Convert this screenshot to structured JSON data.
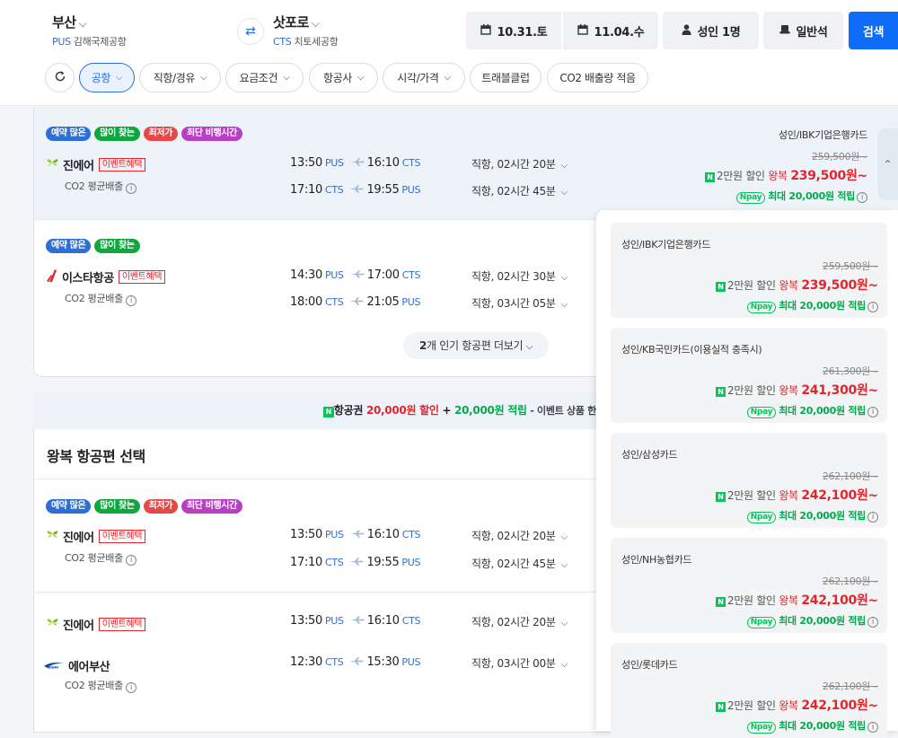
{
  "header": {
    "origin": {
      "city": "부산",
      "code": "PUS",
      "airport": "김해국제공항"
    },
    "destination": {
      "city": "삿포로",
      "code": "CTS",
      "airport": "치토세공항"
    },
    "swap_icon": "⇄",
    "depart_date": "10.31.토",
    "return_date": "11.04.수",
    "passengers": "성인 1명",
    "seat_class": "일반석",
    "search_label": "검색"
  },
  "filters": [
    "공항",
    "직항/경유",
    "요금조건",
    "항공사",
    "시각/가격",
    "트래블클럽",
    "CO2 배출량 적음"
  ],
  "badge_colors": {
    "예약 많은": "#2c6fd6",
    "많이 찾는": "#10a83e",
    "최저가": "#e54848",
    "최단 비행시간": "#b83fc4"
  },
  "labels": {
    "event": "이벤트혜택",
    "co2": "CO2 평균배출",
    "info": "i"
  },
  "results": [
    {
      "badges": [
        "예약 많은",
        "많이 찾는",
        "최저가",
        "최단 비행시간"
      ],
      "airline": "진에어",
      "event": true,
      "co2": true,
      "legs": [
        {
          "dep": "13:50",
          "dep_code": "PUS",
          "arr": "16:10",
          "arr_code": "CTS",
          "duration": "직항, 02시간 20분"
        },
        {
          "dep": "17:10",
          "dep_code": "CTS",
          "arr": "19:55",
          "arr_code": "PUS",
          "duration": "직항, 02시간 45분"
        }
      ],
      "price": {
        "card": "성인/IBK기업은행카드",
        "original": "259,500원~",
        "discount": "2만원 할인",
        "rt": "왕복",
        "price": "239,500원~",
        "point": "최대 20,000원 적립"
      }
    },
    {
      "badges": [
        "예약 많은",
        "많이 찾는"
      ],
      "airline": "이스타항공",
      "event": true,
      "co2": true,
      "legs": [
        {
          "dep": "14:30",
          "dep_code": "PUS",
          "arr": "17:00",
          "arr_code": "CTS",
          "duration": "직항, 02시간 30분"
        },
        {
          "dep": "18:00",
          "dep_code": "CTS",
          "arr": "21:05",
          "arr_code": "PUS",
          "duration": "직항, 03시간 05분"
        }
      ]
    }
  ],
  "more_button": {
    "count": "2",
    "text": "개 인기 항공편 더보기"
  },
  "promo": {
    "part1": "항공권 ",
    "red1": "20,000원 할인",
    "plus": " + ",
    "green1": "20,000원 적립",
    "tail": " - 이벤트 상품 한"
  },
  "section_title": "왕복 항공편 선택",
  "results2": [
    {
      "badges": [
        "예약 많은",
        "많이 찾는",
        "최저가",
        "최단 비행시간"
      ],
      "airline": "진에어",
      "event": true,
      "co2": true,
      "legs": [
        {
          "dep": "13:50",
          "dep_code": "PUS",
          "arr": "16:10",
          "arr_code": "CTS",
          "duration": "직항, 02시간 20분"
        },
        {
          "dep": "17:10",
          "dep_code": "CTS",
          "arr": "19:55",
          "arr_code": "PUS",
          "duration": "직항, 02시간 45분"
        }
      ]
    },
    {
      "airline": "진에어",
      "event": true,
      "airline2": "에어부산",
      "co2": true,
      "legs": [
        {
          "dep": "13:50",
          "dep_code": "PUS",
          "arr": "16:10",
          "arr_code": "CTS",
          "duration": "직항, 02시간 20분"
        },
        {
          "dep": "12:30",
          "dep_code": "CTS",
          "arr": "15:30",
          "arr_code": "PUS",
          "duration": "직항, 03시간 00분"
        }
      ]
    }
  ],
  "card_options": [
    {
      "card": "성인/IBK기업은행카드",
      "original": "259,500원~",
      "discount": "2만원 할인",
      "rt": "왕복",
      "price": "239,500원~",
      "point": "최대 20,000원 적립"
    },
    {
      "card": "성인/KB국민카드(이용실적 충족시)",
      "original": "261,300원~",
      "discount": "2만원 할인",
      "rt": "왕복",
      "price": "241,300원~",
      "point": "최대 20,000원 적립"
    },
    {
      "card": "성인/삼성카드",
      "original": "262,100원~",
      "discount": "2만원 할인",
      "rt": "왕복",
      "price": "242,100원~",
      "point": "최대 20,000원 적립"
    },
    {
      "card": "성인/NH농협카드",
      "original": "262,100원~",
      "discount": "2만원 할인",
      "rt": "왕복",
      "price": "242,100원~",
      "point": "최대 20,000원 적립"
    },
    {
      "card": "성인/롯데카드",
      "original": "262,100원~",
      "discount": "2만원 할인",
      "rt": "왕복",
      "price": "242,100원~",
      "point": "최대 20,000원 적립"
    }
  ],
  "icons": {
    "calendar": "calendar-icon",
    "person": "person-icon",
    "seat": "seat-icon",
    "refresh": "refresh-icon",
    "plane": "plane-icon",
    "chevron": "chevron-down-icon"
  }
}
